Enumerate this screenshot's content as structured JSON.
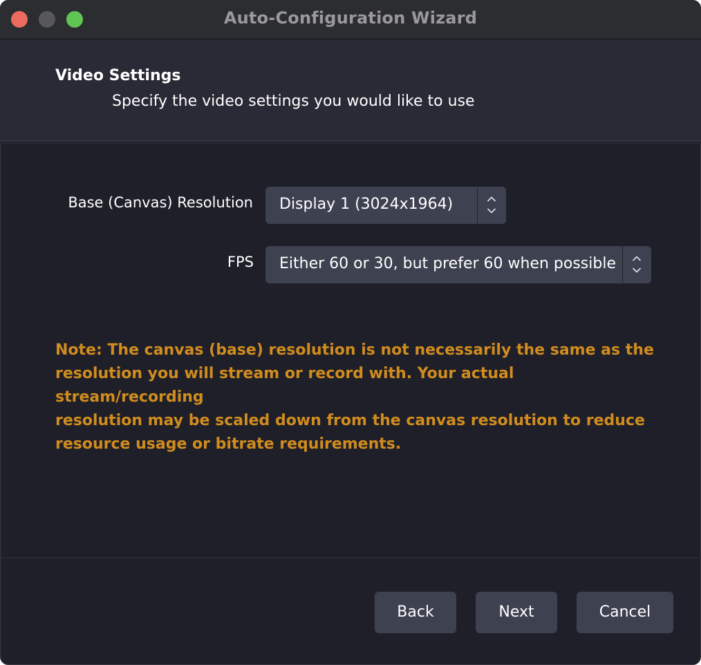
{
  "window": {
    "title": "Auto-Configuration Wizard"
  },
  "header": {
    "title": "Video Settings",
    "subtitle": "Specify the video settings you would like to use"
  },
  "form": {
    "resolution": {
      "label": "Base (Canvas) Resolution",
      "value": "Display 1 (3024x1964)"
    },
    "fps": {
      "label": "FPS",
      "value": "Either 60 or 30, but prefer 60 when possible"
    }
  },
  "note": {
    "lines": [
      "Note: The canvas (base) resolution is not necessarily the same as the",
      "resolution you will stream or record with. Your actual stream/recording",
      "resolution may be scaled down from the canvas resolution to reduce",
      "resource usage or bitrate requirements."
    ]
  },
  "footer": {
    "back_label": "Back",
    "next_label": "Next",
    "cancel_label": "Cancel"
  },
  "icons": {
    "traffic_close": "close-window-icon",
    "traffic_minimize": "minimize-window-icon",
    "traffic_zoom": "zoom-window-icon",
    "select_arrows": "chevron-up-down-icon"
  },
  "colors": {
    "background": "#1e1f29",
    "header_band": "#292a35",
    "control": "#3d4150",
    "note_text": "#d18c1e",
    "traffic_close": "#ec6a5e",
    "traffic_minimize": "#58585b",
    "traffic_zoom": "#61c554"
  }
}
